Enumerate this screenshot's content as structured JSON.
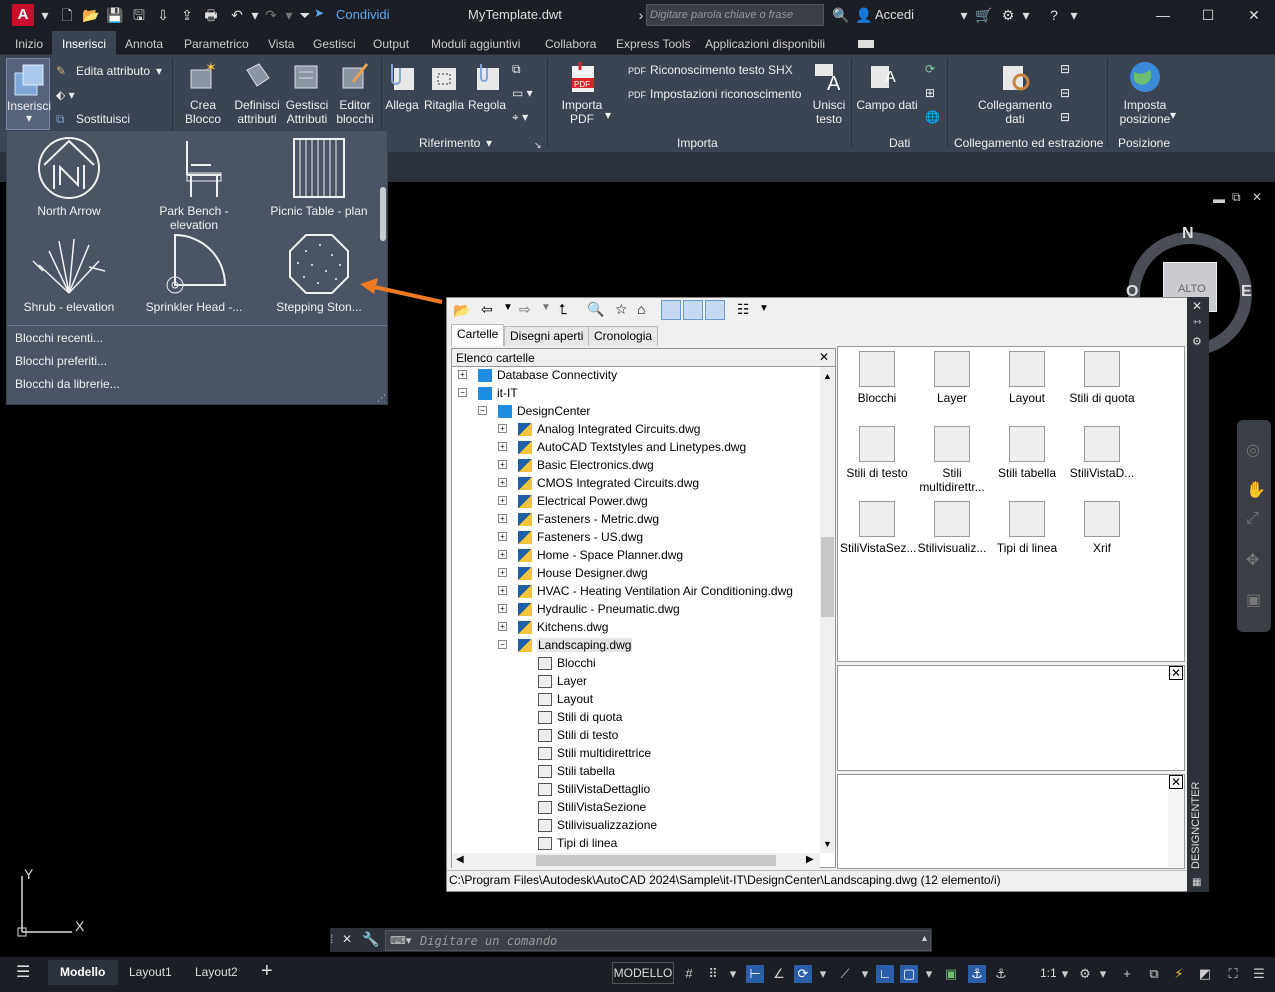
{
  "titlebar": {
    "logo": "A",
    "share": "Condividi",
    "doc_title": "MyTemplate.dwt",
    "search_placeholder": "Digitare parola chiave o frase",
    "login": "Accedi"
  },
  "menu_tabs": [
    "Inizio",
    "Inserisci",
    "Annota",
    "Parametrico",
    "Vista",
    "Gestisci",
    "Output",
    "Moduli aggiuntivi",
    "Collabora",
    "Express Tools",
    "Applicazioni disponibili"
  ],
  "ribbon": {
    "insert": "Inserisci",
    "edit_attr": "Edita attributo",
    "replace": "Sostituisci",
    "create_block": "Crea\nBlocco",
    "define_attr": "Definisci\nattributi",
    "manage_attr": "Gestisci\nAttributi",
    "block_editor": "Editor\nblocchi",
    "attach": "Allega",
    "clip": "Ritaglia",
    "adjust": "Regola",
    "reference_panel": "Riferimento",
    "import_pdf": "Importa\nPDF",
    "shx_recognition": "Riconoscimento testo SHX",
    "recognition_settings": "Impostazioni riconoscimento",
    "merge_text": "Unisci\ntesto",
    "import_panel": "Importa",
    "data_field": "Campo dati",
    "data_panel": "Dati",
    "link_data": "Collegamento\ndati",
    "link_panel": "Collegamento ed estrazione",
    "set_location": "Imposta\nposizione",
    "location_panel": "Posizione"
  },
  "gallery": {
    "items": [
      "North Arrow",
      "Park Bench - elevation",
      "Picnic Table - plan",
      "Shrub - elevation",
      "Sprinkler Head -...",
      "Stepping Ston..."
    ],
    "links": [
      "Blocchi recenti...",
      "Blocchi preferiti...",
      "Blocchi da librerie..."
    ]
  },
  "viewcube": {
    "north": "N",
    "east": "E",
    "top": "ALTO",
    "west": "O"
  },
  "designcenter": {
    "tabs": [
      "Cartelle",
      "Disegni aperti",
      "Cronologia"
    ],
    "tree_header": "Elenco cartelle",
    "tree": [
      {
        "label": "Database Connectivity",
        "level": 1,
        "type": "folder"
      },
      {
        "label": "it-IT",
        "level": 1,
        "type": "folder"
      },
      {
        "label": "DesignCenter",
        "level": 2,
        "type": "folder"
      },
      {
        "label": "Analog Integrated Circuits.dwg",
        "level": 3,
        "type": "dwg"
      },
      {
        "label": "AutoCAD Textstyles and Linetypes.dwg",
        "level": 3,
        "type": "dwg"
      },
      {
        "label": "Basic Electronics.dwg",
        "level": 3,
        "type": "dwg"
      },
      {
        "label": "CMOS Integrated Circuits.dwg",
        "level": 3,
        "type": "dwg"
      },
      {
        "label": "Electrical Power.dwg",
        "level": 3,
        "type": "dwg"
      },
      {
        "label": "Fasteners - Metric.dwg",
        "level": 3,
        "type": "dwg"
      },
      {
        "label": "Fasteners - US.dwg",
        "level": 3,
        "type": "dwg"
      },
      {
        "label": "Home - Space Planner.dwg",
        "level": 3,
        "type": "dwg"
      },
      {
        "label": "House Designer.dwg",
        "level": 3,
        "type": "dwg"
      },
      {
        "label": "HVAC - Heating Ventilation Air Conditioning.dwg",
        "level": 3,
        "type": "dwg"
      },
      {
        "label": "Hydraulic - Pneumatic.dwg",
        "level": 3,
        "type": "dwg"
      },
      {
        "label": "Kitchens.dwg",
        "level": 3,
        "type": "dwg"
      },
      {
        "label": "Landscaping.dwg",
        "level": 3,
        "type": "dwg"
      },
      {
        "label": "Blocchi",
        "level": 4,
        "type": "item"
      },
      {
        "label": "Layer",
        "level": 4,
        "type": "item"
      },
      {
        "label": "Layout",
        "level": 4,
        "type": "item"
      },
      {
        "label": "Stili di quota",
        "level": 4,
        "type": "item"
      },
      {
        "label": "Stili di testo",
        "level": 4,
        "type": "item"
      },
      {
        "label": "Stili multidirettrice",
        "level": 4,
        "type": "item"
      },
      {
        "label": "Stili tabella",
        "level": 4,
        "type": "item"
      },
      {
        "label": "StiliVistaDettaglio",
        "level": 4,
        "type": "item"
      },
      {
        "label": "StiliVistaSezione",
        "level": 4,
        "type": "item"
      },
      {
        "label": "Stilivisualizzazione",
        "level": 4,
        "type": "item"
      },
      {
        "label": "Tipi di linea",
        "level": 4,
        "type": "item"
      }
    ],
    "content": [
      "Blocchi",
      "Layer",
      "Layout",
      "Stili di quota",
      "Stili di testo",
      "Stili multidirettr...",
      "Stili tabella",
      "StiliVistaD...",
      "StiliVistaSez...",
      "Stilivisualiz...",
      "Tipi di linea",
      "Xrif"
    ],
    "status": "C:\\Program Files\\Autodesk\\AutoCAD 2024\\Sample\\it-IT\\DesignCenter\\Landscaping.dwg (12 elemento/i)",
    "side_label": "DESIGNCENTER"
  },
  "command": {
    "placeholder": "Digitare un comando"
  },
  "ucs": {
    "x": "X",
    "y": "Y"
  },
  "bottom": {
    "tabs": [
      "Modello",
      "Layout1",
      "Layout2"
    ],
    "model_button": "MODELLO",
    "scale": "1:1"
  }
}
